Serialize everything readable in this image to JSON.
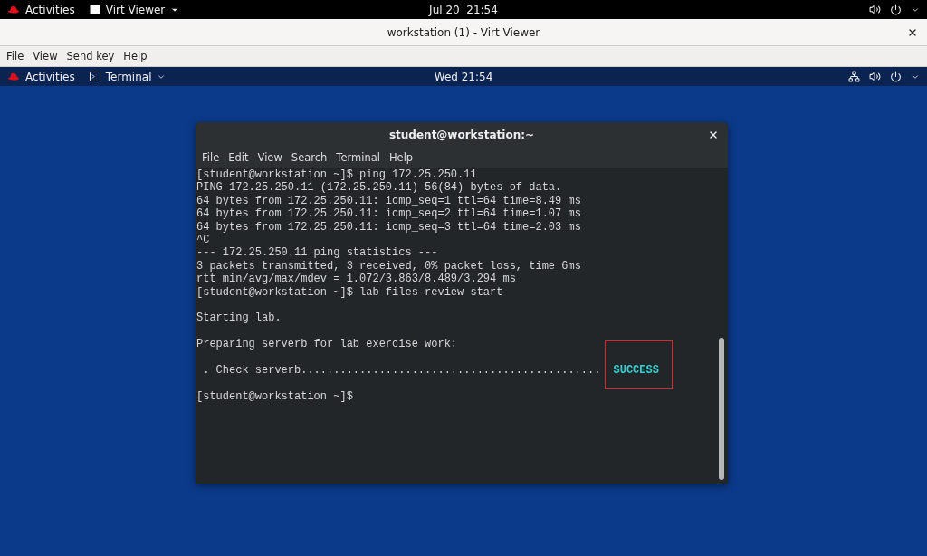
{
  "host_top_bar": {
    "activities": "Activities",
    "app_menu": "Virt Viewer",
    "clock": "Jul 20  21:54"
  },
  "viewer_window": {
    "title": "workstation (1) - Virt Viewer",
    "menu": [
      "File",
      "View",
      "Send key",
      "Help"
    ]
  },
  "guest_top_bar": {
    "activities": "Activities",
    "app_menu": "Terminal",
    "clock": "Wed 21:54"
  },
  "terminal": {
    "title": "student@workstation:~",
    "menu": [
      "File",
      "Edit",
      "View",
      "Search",
      "Terminal",
      "Help"
    ],
    "lines": [
      {
        "kind": "text",
        "text": "[student@workstation ~]$ ping 172.25.250.11"
      },
      {
        "kind": "text",
        "text": "PING 172.25.250.11 (172.25.250.11) 56(84) bytes of data."
      },
      {
        "kind": "text",
        "text": "64 bytes from 172.25.250.11: icmp_seq=1 ttl=64 time=8.49 ms"
      },
      {
        "kind": "text",
        "text": "64 bytes from 172.25.250.11: icmp_seq=2 ttl=64 time=1.07 ms"
      },
      {
        "kind": "text",
        "text": "64 bytes from 172.25.250.11: icmp_seq=3 ttl=64 time=2.03 ms"
      },
      {
        "kind": "text",
        "text": "^C"
      },
      {
        "kind": "text",
        "text": "--- 172.25.250.11 ping statistics ---"
      },
      {
        "kind": "text",
        "text": "3 packets transmitted, 3 received, 0% packet loss, time 6ms"
      },
      {
        "kind": "text",
        "text": "rtt min/avg/max/mdev = 1.072/3.863/8.489/3.294 ms"
      },
      {
        "kind": "text",
        "text": "[student@workstation ~]$ lab files-review start"
      },
      {
        "kind": "blank"
      },
      {
        "kind": "text",
        "text": "Starting lab."
      },
      {
        "kind": "blank"
      },
      {
        "kind": "text",
        "text": "Preparing serverb for lab exercise work:"
      },
      {
        "kind": "blank"
      },
      {
        "kind": "status",
        "text": " . Check serverb..............................................",
        "status": "SUCCESS",
        "highlighted": true
      },
      {
        "kind": "blank"
      },
      {
        "kind": "text",
        "text": "[student@workstation ~]$"
      }
    ]
  }
}
